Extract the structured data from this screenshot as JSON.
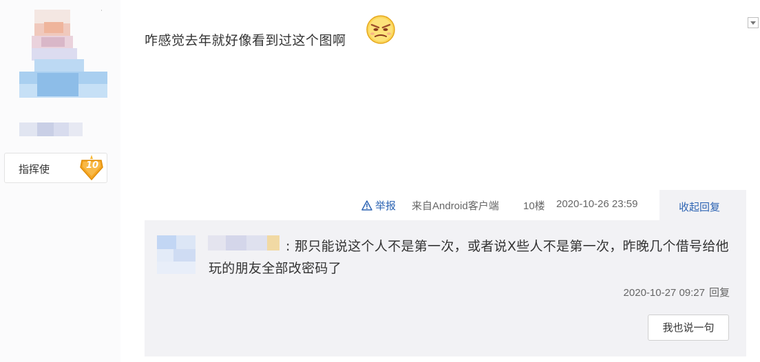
{
  "user": {
    "badge_name": "指挥使",
    "level": "10",
    "badge_color": "#f5a623"
  },
  "post": {
    "content": "咋感觉去年就好像看到过这个图啊",
    "emoji": "grumpy-face-emoji"
  },
  "meta": {
    "report_label": "举报",
    "source": "来自Android客户端",
    "floor": "10楼",
    "time": "2020-10-26 23:59",
    "collapse_label": "收起回复"
  },
  "reply": {
    "content": ": 那只能说这个人不是第一次，或者说X些人不是第一次，昨晚几个借号给他玩的朋友全部改密码了",
    "time": "2020-10-27 09:27",
    "reply_label": "回复",
    "say_button": "我也说一句"
  },
  "colors": {
    "link": "#2d64b3",
    "reply_bg": "#f2f2f5"
  }
}
